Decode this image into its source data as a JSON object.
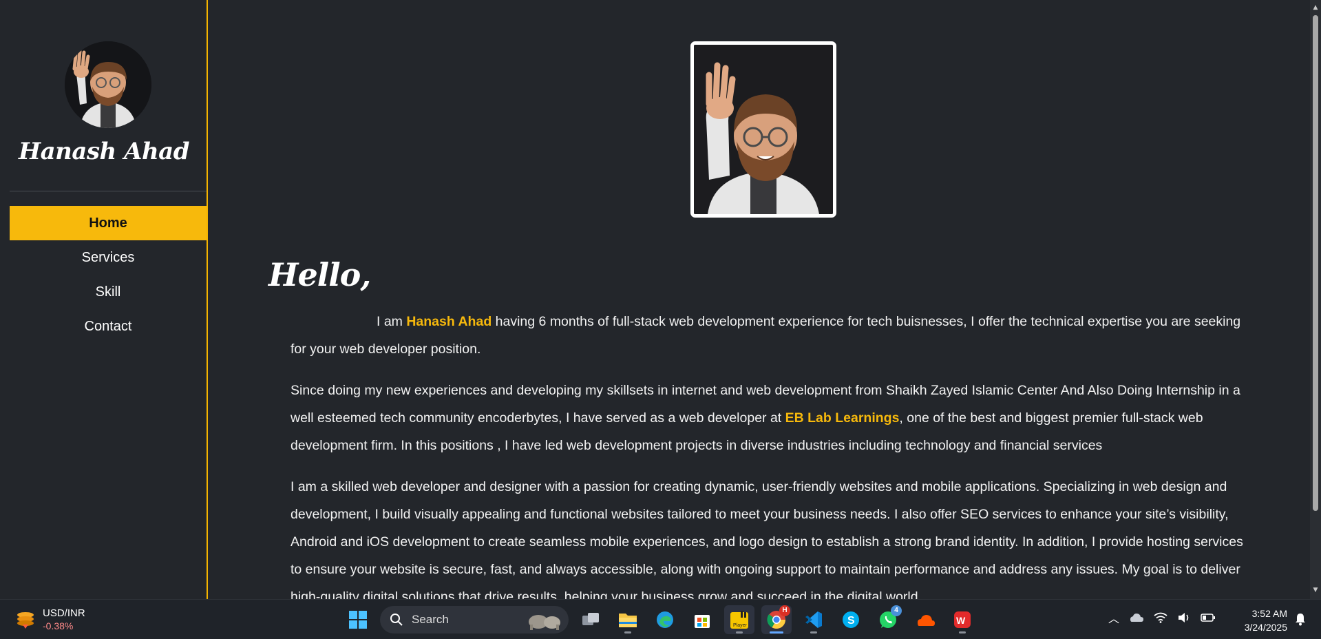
{
  "sidebar": {
    "brand_name": "Hanash Ahad",
    "nav": [
      {
        "label": "Home",
        "active": true
      },
      {
        "label": "Services",
        "active": false
      },
      {
        "label": "Skill",
        "active": false
      },
      {
        "label": "Contact",
        "active": false
      }
    ]
  },
  "main": {
    "greeting": "Hello,",
    "intro": {
      "prefix": "I am ",
      "name": "Hanash Ahad",
      "suffix": " having 6 months of full-stack web development experience for tech buisnesses, I offer the technical expertise you are seeking for your web developer position."
    },
    "experience": {
      "prefix": "Since doing my new experiences and developing my skillsets in internet and web development from Shaikh Zayed Islamic Center And Also Doing Internship in a well esteemed tech community encoderbytes, I have served as a web developer at ",
      "company": "EB Lab Learnings",
      "suffix": ", one of the best and biggest premier full-stack web development firm. In this positions , I have led web development projects in diverse industries including technology and financial services"
    },
    "skills_paragraph": "I am a skilled web developer and designer with a passion for creating dynamic, user-friendly websites and mobile applications. Specializing in web design and development, I build visually appealing and functional websites tailored to meet your business needs. I also offer SEO services to enhance your site’s visibility, Android and iOS development to create seamless mobile experiences, and logo design to establish a strong brand identity. In addition, I provide hosting services to ensure your website is secure, fast, and always accessible, along with ongoing support to maintain performance and address any issues. My goal is to deliver high-quality digital solutions that drive results, helping your business grow and succeed in the digital world."
  },
  "colors": {
    "accent": "#f7b90c",
    "background": "#23262b",
    "text": "#f2f2f2"
  },
  "taskbar": {
    "stock_symbol": "USD/INR",
    "stock_change": "-0.38%",
    "search_label": "Search",
    "apps": [
      "task-view-icon",
      "file-explorer-icon",
      "edge-icon",
      "microsoft-store-icon",
      "player-icon",
      "chrome-icon",
      "vscode-icon",
      "skype-icon",
      "whatsapp-icon",
      "soundcloud-icon",
      "wps-office-icon"
    ],
    "chrome_badge": "H",
    "whatsapp_badge": "4",
    "time": "3:52 AM",
    "date": "3/24/2025"
  }
}
